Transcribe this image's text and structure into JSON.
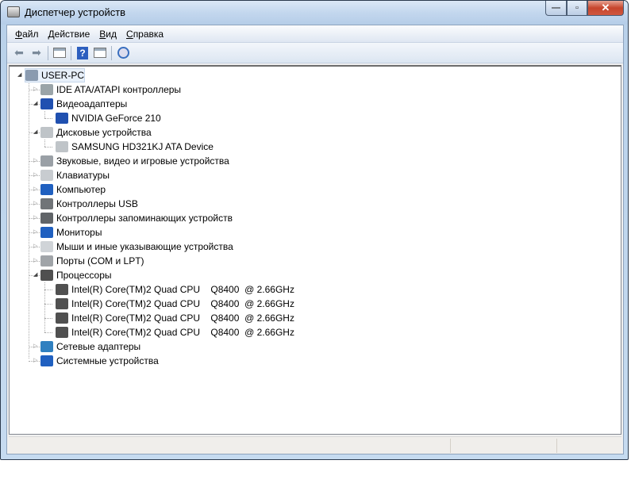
{
  "window": {
    "title": "Диспетчер устройств",
    "minimize": "—",
    "maximize": "▫",
    "close": "✕"
  },
  "menu": [
    {
      "label": "Файл",
      "u": "Ф",
      "rest": "айл"
    },
    {
      "label": "Действие",
      "u": "Д",
      "rest": "ействие"
    },
    {
      "label": "Вид",
      "u": "В",
      "rest": "ид"
    },
    {
      "label": "Справка",
      "u": "С",
      "rest": "правка"
    }
  ],
  "toolbar": [
    "back-icon",
    "forward-icon",
    "show-hide-console-tree-icon",
    "help-icon",
    "properties-icon",
    "scan-hardware-icon"
  ],
  "tree": [
    {
      "label": "USER-PC",
      "level": 0,
      "state": "open",
      "icon": "computer-icon",
      "color": "#8a9bb0"
    },
    {
      "label": "IDE ATA/ATAPI контроллеры",
      "level": 1,
      "state": "closed",
      "icon": "ide-controller-icon",
      "color": "#9aa4a8"
    },
    {
      "label": "Видеоадаптеры",
      "level": 1,
      "state": "open",
      "icon": "display-adapter-icon",
      "color": "#2050b0"
    },
    {
      "label": "NVIDIA GeForce 210",
      "level": 2,
      "state": "leaf",
      "icon": "display-adapter-icon",
      "color": "#2050b0"
    },
    {
      "label": "Дисковые устройства",
      "level": 1,
      "state": "open",
      "icon": "disk-drive-icon",
      "color": "#bfc4c8"
    },
    {
      "label": "SAMSUNG HD321KJ ATA Device",
      "level": 2,
      "state": "leaf",
      "icon": "disk-drive-icon",
      "color": "#bfc4c8"
    },
    {
      "label": "Звуковые, видео и игровые устройства",
      "level": 1,
      "state": "closed",
      "icon": "speaker-icon",
      "color": "#9aa0a6"
    },
    {
      "label": "Клавиатуры",
      "level": 1,
      "state": "closed",
      "icon": "keyboard-icon",
      "color": "#c8ccd0"
    },
    {
      "label": "Компьютер",
      "level": 1,
      "state": "closed",
      "icon": "computer-icon",
      "color": "#2060c0"
    },
    {
      "label": "Контроллеры USB",
      "level": 1,
      "state": "closed",
      "icon": "usb-icon",
      "color": "#707478"
    },
    {
      "label": "Контроллеры запоминающих устройств",
      "level": 1,
      "state": "closed",
      "icon": "storage-controller-icon",
      "color": "#606468"
    },
    {
      "label": "Мониторы",
      "level": 1,
      "state": "closed",
      "icon": "monitor-icon",
      "color": "#2060c0"
    },
    {
      "label": "Мыши и иные указывающие устройства",
      "level": 1,
      "state": "closed",
      "icon": "mouse-icon",
      "color": "#d0d4d8"
    },
    {
      "label": "Порты (COM и LPT)",
      "level": 1,
      "state": "closed",
      "icon": "port-icon",
      "color": "#a0a4a8"
    },
    {
      "label": "Процессоры",
      "level": 1,
      "state": "open",
      "icon": "processor-icon",
      "color": "#505050"
    },
    {
      "label": "Intel(R) Core(TM)2 Quad CPU    Q8400  @ 2.66GHz",
      "level": 2,
      "state": "leaf",
      "icon": "processor-icon",
      "color": "#505050"
    },
    {
      "label": "Intel(R) Core(TM)2 Quad CPU    Q8400  @ 2.66GHz",
      "level": 2,
      "state": "leaf",
      "icon": "processor-icon",
      "color": "#505050"
    },
    {
      "label": "Intel(R) Core(TM)2 Quad CPU    Q8400  @ 2.66GHz",
      "level": 2,
      "state": "leaf",
      "icon": "processor-icon",
      "color": "#505050"
    },
    {
      "label": "Intel(R) Core(TM)2 Quad CPU    Q8400  @ 2.66GHz",
      "level": 2,
      "state": "leaf",
      "icon": "processor-icon",
      "color": "#505050"
    },
    {
      "label": "Сетевые адаптеры",
      "level": 1,
      "state": "closed",
      "icon": "network-adapter-icon",
      "color": "#3080c0"
    },
    {
      "label": "Системные устройства",
      "level": 1,
      "state": "closed",
      "icon": "system-devices-icon",
      "color": "#2060c0"
    }
  ]
}
